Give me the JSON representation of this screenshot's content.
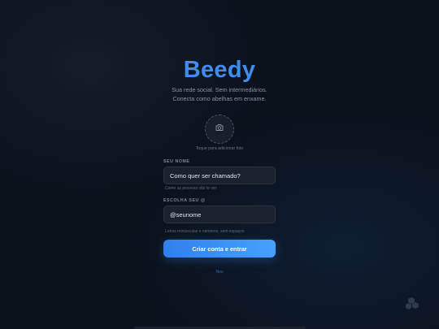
{
  "app": {
    "brand": "Beedy",
    "tagline_line1": "Sua rede social. Sem intermediários.",
    "tagline_line2": "Conecta como abelhas em enxame.",
    "accent_color": "#3d8ef0"
  },
  "avatar": {
    "icon": "camera-icon",
    "hint": "Toque para adicionar foto"
  },
  "name_field": {
    "label": "SEU NOME",
    "placeholder": "Como quer ser chamado?",
    "hint": "Como as pessoas vão te ver"
  },
  "handle_field": {
    "label": "ESCOLHA SEU @",
    "placeholder": "@seunome",
    "hint": "Letras minúsculas e números, sem espaços"
  },
  "submit": {
    "label": "Criar conta e entrar"
  },
  "footer": {
    "link": "Nos"
  }
}
